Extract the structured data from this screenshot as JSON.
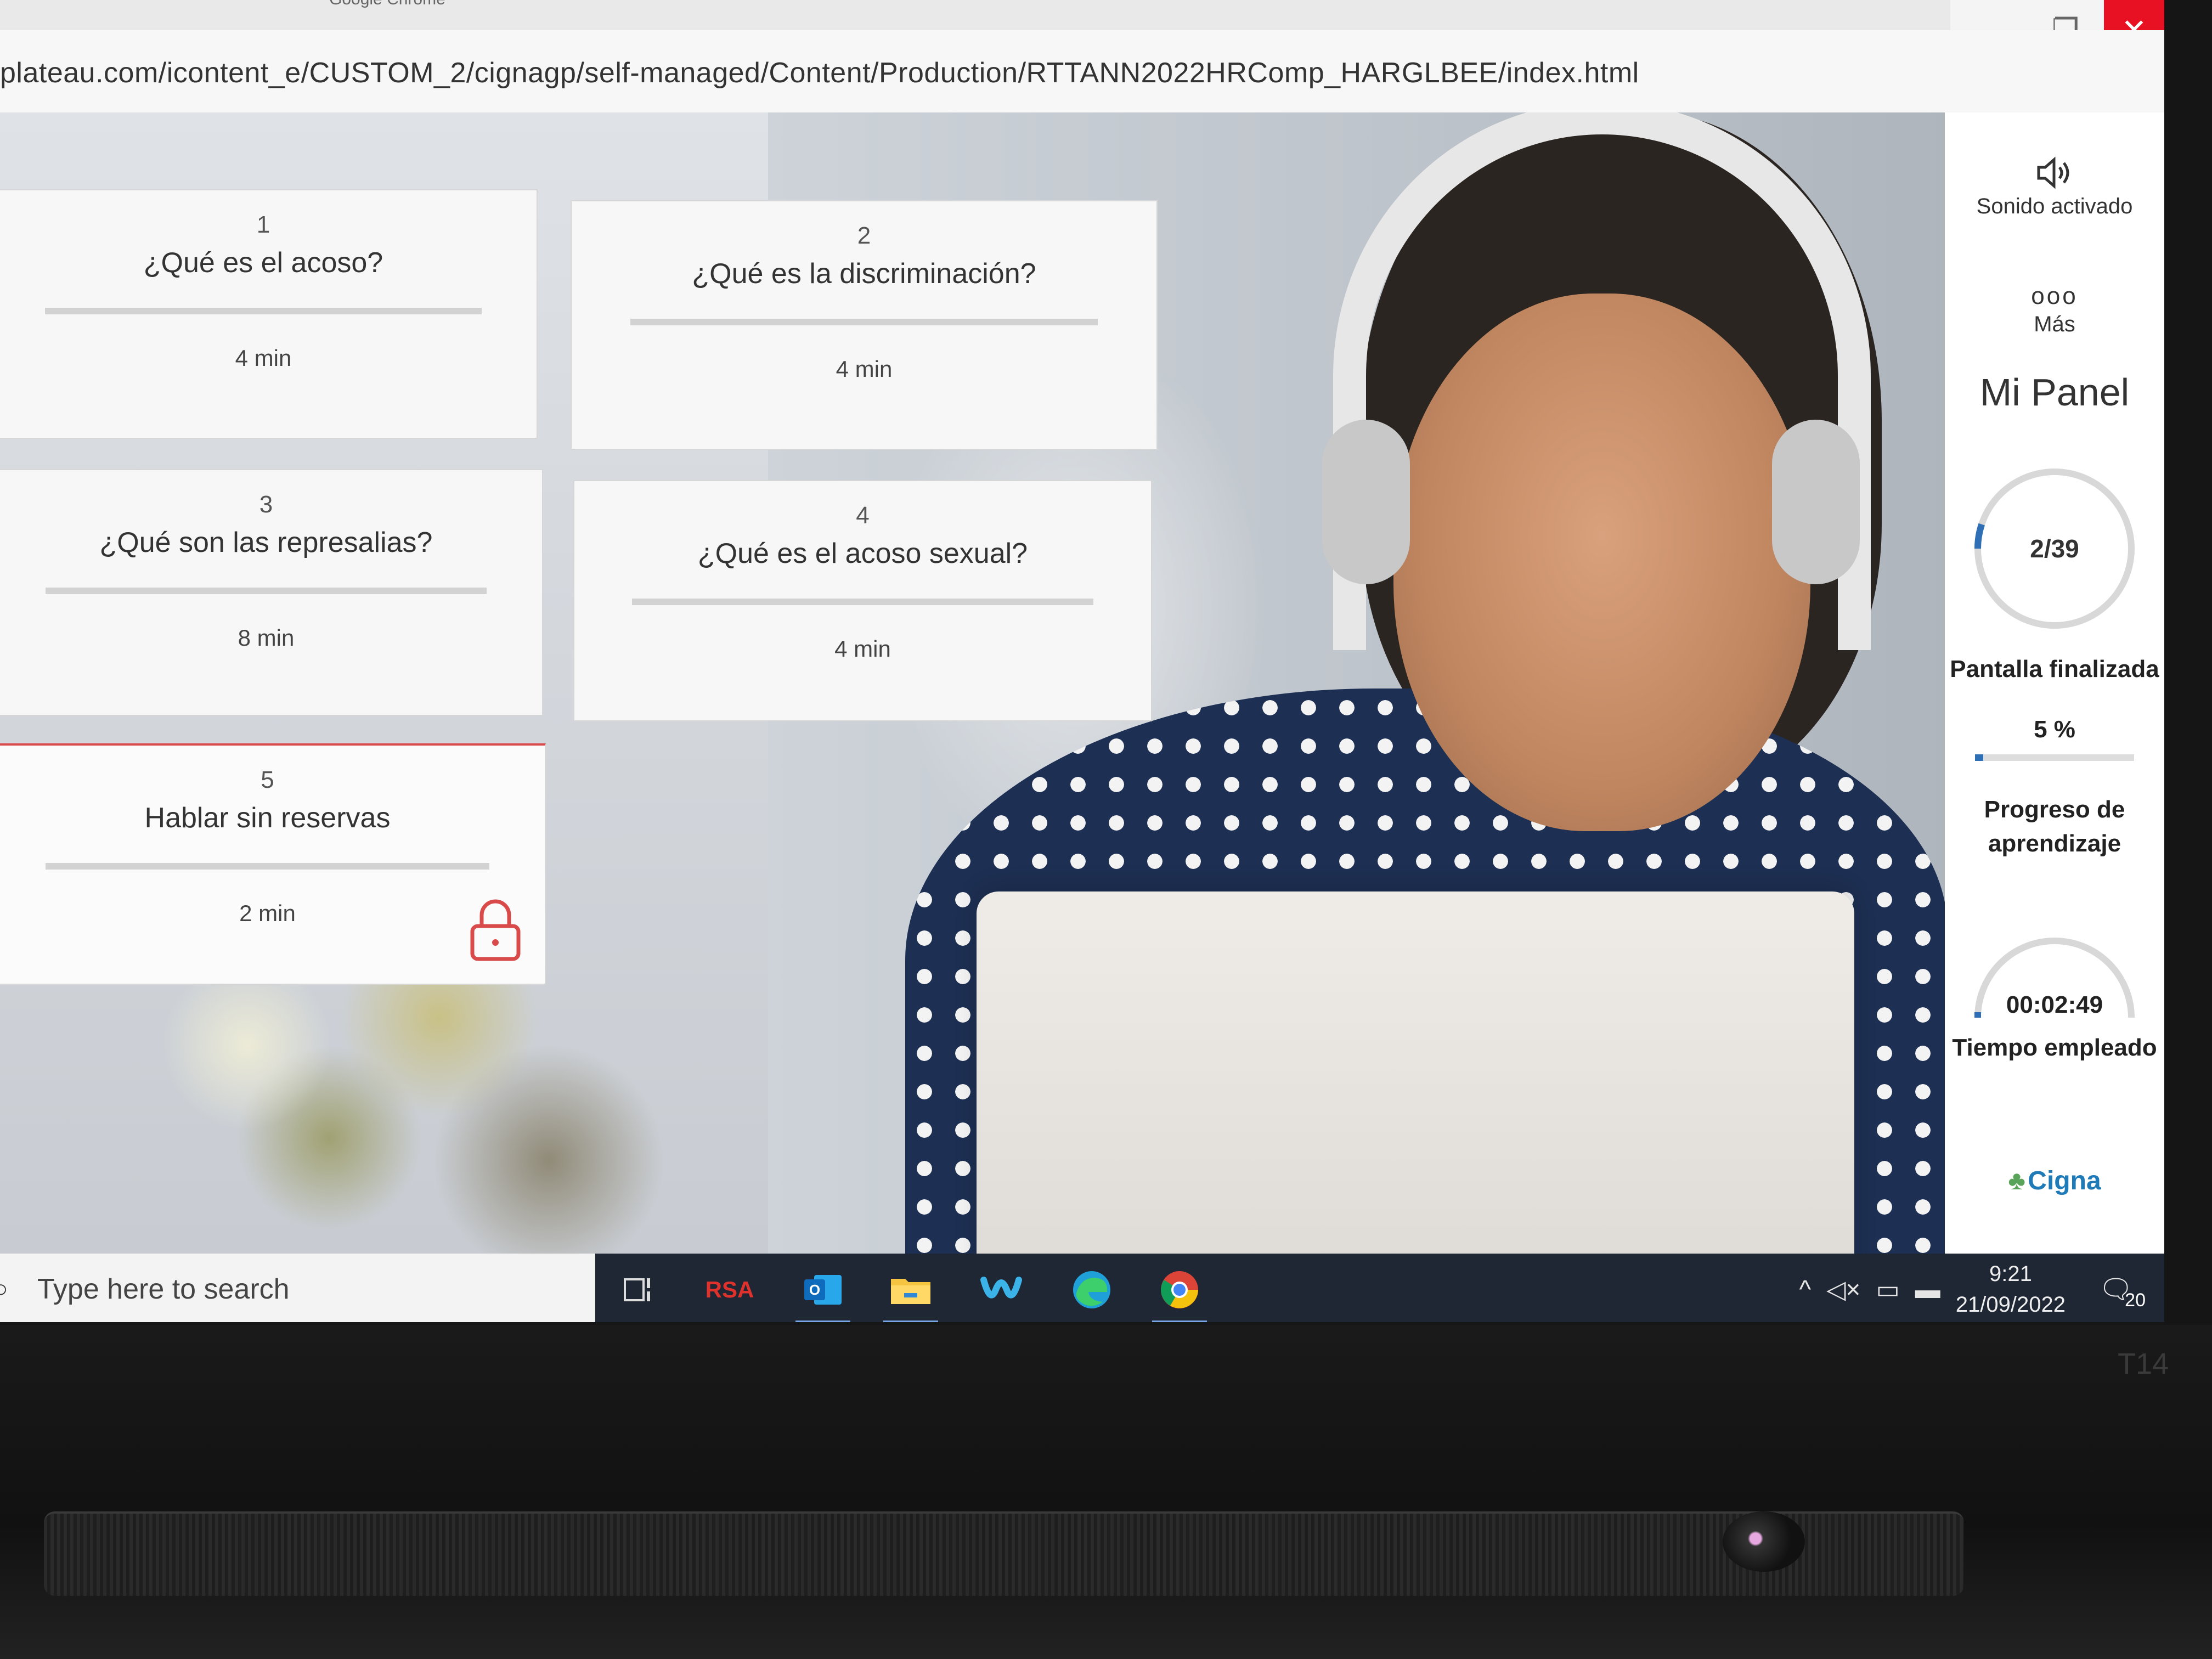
{
  "window": {
    "app_title": "Google Chrome",
    "url": "plateau.com/icontent_e/CUSTOM_2/cignagp/self-managed/Content/Production/RTTANN2022HRComp_HARGLBEE/index.html",
    "minimize_glyph": "—",
    "restore_glyph": "❐",
    "close_glyph": "✕"
  },
  "topics": [
    {
      "number": "1",
      "title": "¿Qué es el acoso?",
      "duration": "4 min",
      "locked": false
    },
    {
      "number": "2",
      "title": "¿Qué es la discriminación?",
      "duration": "4 min",
      "locked": false
    },
    {
      "number": "3",
      "title": "¿Qué son las represalias?",
      "duration": "8 min",
      "locked": false
    },
    {
      "number": "4",
      "title": "¿Qué es el acoso sexual?",
      "duration": "4 min",
      "locked": false
    },
    {
      "number": "5",
      "title": "Hablar sin reservas",
      "duration": "2 min",
      "locked": true
    }
  ],
  "panel": {
    "sound_label": "Sonido activado",
    "sound_icon": "speaker-icon",
    "more_label": "Más",
    "more_glyph": "ooo",
    "title": "Mi Panel",
    "screens": {
      "value": "2/39",
      "done": 2,
      "total": 39,
      "label": "Pantalla finalizada"
    },
    "progress": {
      "value": "5 %",
      "fraction": 0.05,
      "label": "Progreso de aprendizaje"
    },
    "time": {
      "value": "00:02:49",
      "label": "Tiempo empleado"
    },
    "brand": "Cigna",
    "accent": "#2f6fb5"
  },
  "taskbar": {
    "search_placeholder": "Type here to search",
    "apps": [
      "task-view-icon",
      "rsa-icon",
      "outlook-icon",
      "file-explorer-icon",
      "webex-icon",
      "edge-icon",
      "chrome-icon"
    ],
    "rsa_label": "RSA",
    "time": "9:21",
    "date": "21/09/2022",
    "notification_count": "20"
  },
  "device": {
    "model": "T14"
  }
}
